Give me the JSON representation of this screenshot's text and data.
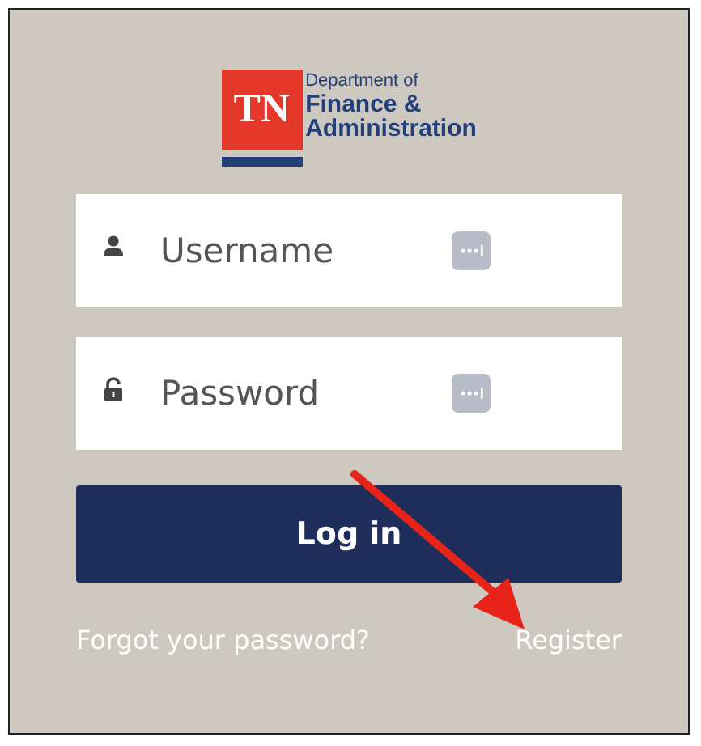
{
  "logo": {
    "mark": "TN",
    "line_1": "Department of",
    "line_2": "Finance &",
    "line_3": "Administration"
  },
  "fields": [
    {
      "kind": "user",
      "placeholder": "Username"
    },
    {
      "kind": "lock",
      "placeholder": "Password"
    }
  ],
  "login_button": "Log in",
  "links": [
    "Forgot your password?",
    "Register"
  ]
}
